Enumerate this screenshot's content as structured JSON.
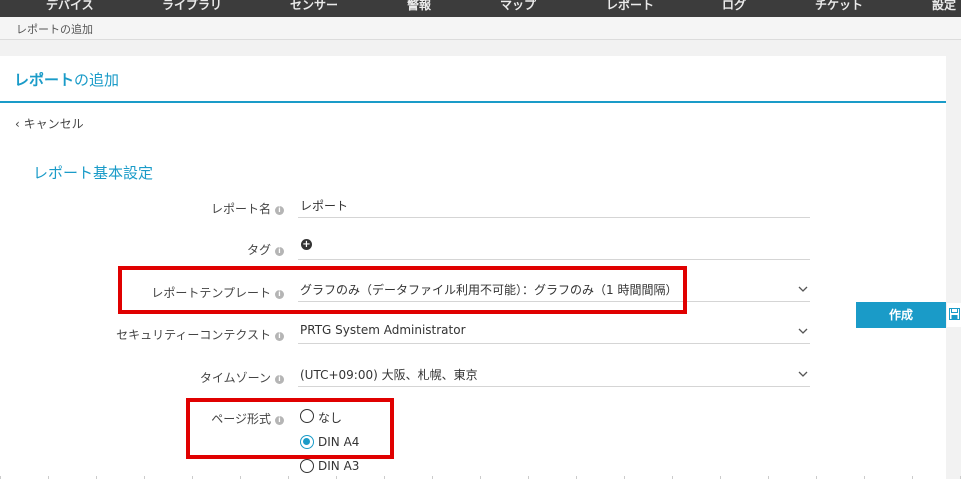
{
  "nav": {
    "items": [
      "デバイス",
      "ライブラリ",
      "センサー",
      "警報",
      "マップ",
      "レポート",
      "ログ",
      "チケット",
      "設定"
    ]
  },
  "breadcrumb": "レポートの追加",
  "page": {
    "title_bold": "レポート",
    "title_rest": "の追加",
    "cancel": "キャンセル"
  },
  "section": {
    "title": "レポート基本設定"
  },
  "form": {
    "report_name": {
      "label": "レポート名",
      "value": "レポート"
    },
    "tags": {
      "label": "タグ"
    },
    "template": {
      "label": "レポートテンプレート",
      "value": "グラフのみ（データファイル利用不可能）：グラフのみ（1 時間間隔）"
    },
    "security": {
      "label": "セキュリティーコンテクスト",
      "value": "PRTG System Administrator"
    },
    "timezone": {
      "label": "タイムゾーン",
      "value": "(UTC+09:00) 大阪、札幌、東京"
    },
    "page_format": {
      "label": "ページ形式",
      "options": [
        "なし",
        "DIN A4",
        "DIN A3"
      ],
      "selected": "DIN A4"
    }
  },
  "actions": {
    "create": "作成"
  },
  "colors": {
    "accent": "#1a9bc8",
    "highlight": "#e00000",
    "nav_bg": "#3c3c3c"
  }
}
